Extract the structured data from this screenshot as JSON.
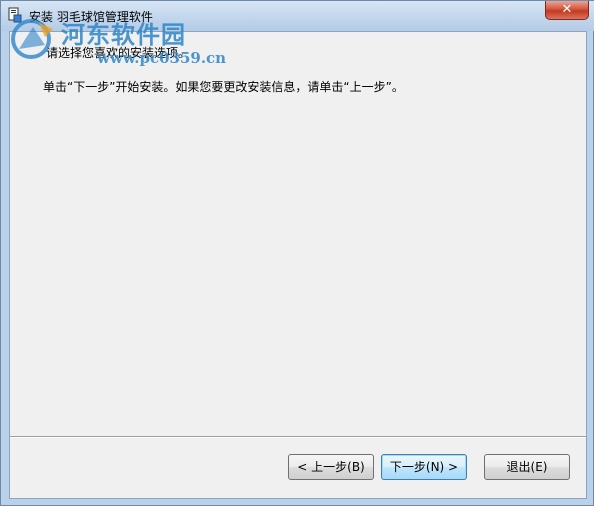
{
  "window": {
    "title": "安装 羽毛球馆管理软件",
    "close_label": "✕"
  },
  "watermark": {
    "title": "河东软件园",
    "url": "www.pc0359.cn"
  },
  "content": {
    "subtitle": "请选择您喜欢的安装选项。",
    "instruction": "单击“下一步”开始安装。如果您要更改安装信息，请单击“上一步”。"
  },
  "buttons": {
    "back": "< 上一步(B)",
    "next": "下一步(N) >",
    "cancel": "退出(E)"
  },
  "colors": {
    "frame": "#b9d1ea",
    "client": "#f0f0f0",
    "close": "#c43a22",
    "watermark": "#2f86c8"
  }
}
